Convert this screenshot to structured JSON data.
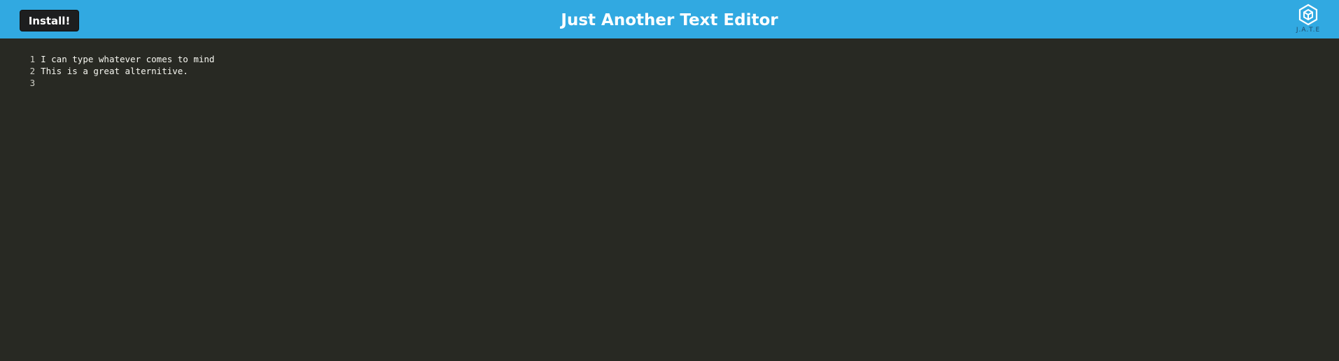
{
  "header": {
    "install_label": "Install!",
    "title": "Just Another Text Editor",
    "logo_text": "J.A.T.E"
  },
  "editor": {
    "lines": [
      {
        "number": "1",
        "text": "I can type whatever comes to mind"
      },
      {
        "number": "2",
        "text": "This is a great alternitive."
      },
      {
        "number": "3",
        "text": ""
      }
    ]
  },
  "colors": {
    "navbar": "#31a9e1",
    "editor_background": "#282923",
    "button_background": "#1d1e1f",
    "text": "#f8f8f2"
  }
}
